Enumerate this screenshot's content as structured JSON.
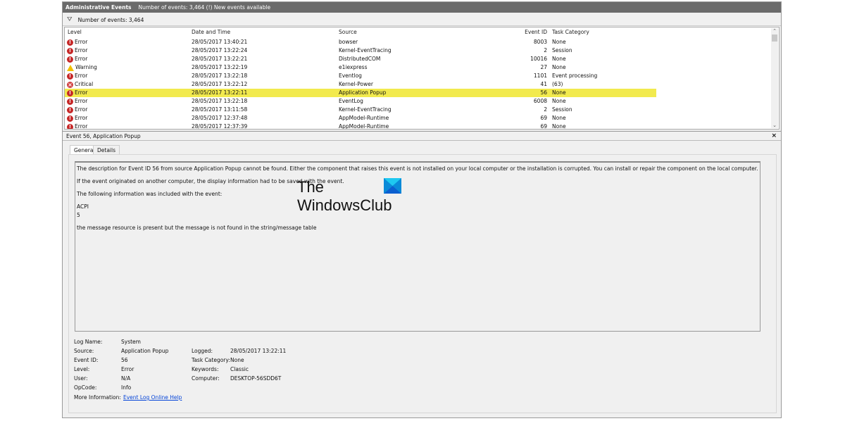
{
  "header": {
    "title": "Administrative Events",
    "subtitle": "Number of events: 3,464 (!) New events available"
  },
  "toolbar": {
    "filter_icon": "filter-icon",
    "count": "Number of events: 3,464"
  },
  "table": {
    "columns": [
      "Level",
      "Date and Time",
      "Source",
      "Event ID",
      "Task Category"
    ],
    "rows": [
      {
        "level": "Error",
        "icon": "error-icon",
        "date": "28/05/2017 13:40:21",
        "source": "bowser",
        "id": "8003",
        "category": "None"
      },
      {
        "level": "Error",
        "icon": "error-icon",
        "date": "28/05/2017 13:22:24",
        "source": "Kernel-EventTracing",
        "id": "2",
        "category": "Session"
      },
      {
        "level": "Error",
        "icon": "error-icon",
        "date": "28/05/2017 13:22:21",
        "source": "DistributedCOM",
        "id": "10016",
        "category": "None"
      },
      {
        "level": "Warning",
        "icon": "warning-icon",
        "date": "28/05/2017 13:22:19",
        "source": "e1iexpress",
        "id": "27",
        "category": "None"
      },
      {
        "level": "Error",
        "icon": "error-icon",
        "date": "28/05/2017 13:22:18",
        "source": "Eventlog",
        "id": "1101",
        "category": "Event processing"
      },
      {
        "level": "Critical",
        "icon": "critical-icon",
        "date": "28/05/2017 13:22:12",
        "source": "Kernel-Power",
        "id": "41",
        "category": "(63)"
      },
      {
        "level": "Error",
        "icon": "error-icon",
        "date": "28/05/2017 13:22:11",
        "source": "Application Popup",
        "id": "56",
        "category": "None",
        "selected": true
      },
      {
        "level": "Error",
        "icon": "error-icon",
        "date": "28/05/2017 13:22:18",
        "source": "EventLog",
        "id": "6008",
        "category": "None"
      },
      {
        "level": "Error",
        "icon": "error-icon",
        "date": "28/05/2017 13:11:58",
        "source": "Kernel-EventTracing",
        "id": "2",
        "category": "Session"
      },
      {
        "level": "Error",
        "icon": "error-icon",
        "date": "28/05/2017 12:37:48",
        "source": "AppModel-Runtime",
        "id": "69",
        "category": "None"
      },
      {
        "level": "Error",
        "icon": "error-icon",
        "date": "28/05/2017 12:37:39",
        "source": "AppModel-Runtime",
        "id": "69",
        "category": "None"
      }
    ],
    "highlight_color": "#f2ea4e"
  },
  "detail": {
    "title": "Event 56, Application Popup",
    "close": "×",
    "tabs": [
      "General",
      "Details"
    ],
    "description": [
      "The description for Event ID 56 from source Application Popup cannot be found. Either the component that raises this event is not installed on your local computer or the installation is corrupted. You can install or repair the component on the local computer.",
      "If the event originated on another computer, the display information had to be saved with the event.",
      "The following information was included with the event:",
      "ACPI",
      "5",
      "the message resource is present but the message is not found in the string/message table"
    ],
    "props": {
      "log_name_label": "Log Name:",
      "log_name": "System",
      "source_label": "Source:",
      "source": "Application Popup",
      "logged_label": "Logged:",
      "logged": "28/05/2017 13:22:11",
      "event_id_label": "Event ID:",
      "event_id": "56",
      "task_label": "Task Category:",
      "task": "None",
      "level_label": "Level:",
      "level": "Error",
      "keywords_label": "Keywords:",
      "keywords": "Classic",
      "user_label": "User:",
      "user": "N/A",
      "computer_label": "Computer:",
      "computer": "DESKTOP-56SDD6T",
      "opcode_label": "OpCode:",
      "opcode": "Info",
      "more_label": "More Information:",
      "more_link": "Event Log Online Help"
    }
  },
  "watermark": {
    "line1": "The",
    "line2": "WindowsClub"
  }
}
